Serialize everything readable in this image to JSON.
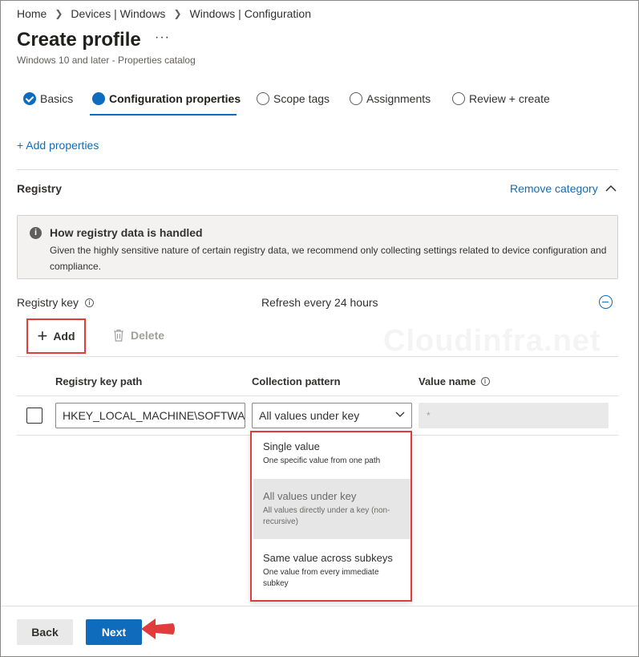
{
  "breadcrumb": [
    "Home",
    "Devices | Windows",
    "Windows | Configuration"
  ],
  "page": {
    "title": "Create profile",
    "more": "···",
    "subtitle": "Windows 10 and later - Properties catalog"
  },
  "tabs": [
    {
      "label": "Basics",
      "state": "done"
    },
    {
      "label": "Configuration properties",
      "state": "active"
    },
    {
      "label": "Scope tags",
      "state": "pending"
    },
    {
      "label": "Assignments",
      "state": "pending"
    },
    {
      "label": "Review + create",
      "state": "pending"
    }
  ],
  "add_properties": "+ Add properties",
  "section": {
    "title": "Registry",
    "remove_label": "Remove category"
  },
  "info": {
    "icon": "i",
    "title": "How registry data is handled",
    "body": "Given the highly sensitive nature of certain registry data, we recommend only collecting settings related to device configuration and compliance."
  },
  "registry": {
    "label": "Registry key",
    "info_icon": "i",
    "refresh": "Refresh every 24 hours"
  },
  "toolbar": {
    "add_label": "Add",
    "add_symbol": "+",
    "delete_label": "Delete"
  },
  "watermark": "Cloudinfra.net",
  "table": {
    "headers": [
      "Registry key path",
      "Collection pattern",
      "Value name"
    ],
    "value_name_info_icon": "i",
    "row": {
      "path": "HKEY_LOCAL_MACHINE\\SOFTWA...",
      "pattern": "All values under key",
      "value_placeholder": "*"
    }
  },
  "dropdown": {
    "options": [
      {
        "title": "Single value",
        "desc": "One specific value from one path",
        "selected": false
      },
      {
        "title": "All values under key",
        "desc": "All values directly under a key (non-recursive)",
        "selected": true
      },
      {
        "title": "Same value across subkeys",
        "desc": "One value from every immediate subkey",
        "selected": false
      }
    ]
  },
  "footer": {
    "back_label": "Back",
    "next_label": "Next"
  },
  "colors": {
    "accent": "#0f6cbd",
    "highlight": "#e03c3c"
  }
}
